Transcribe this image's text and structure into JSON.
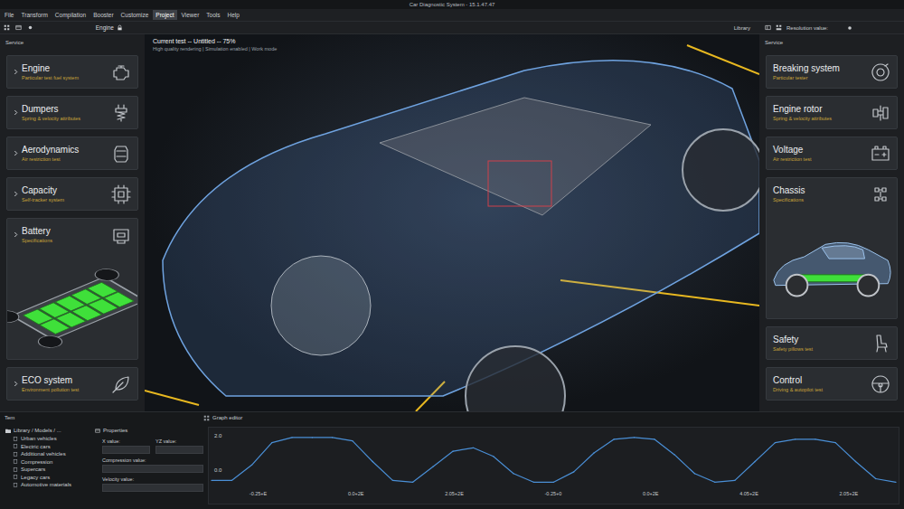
{
  "window": {
    "title": "Car Diagnostic System - 15.1.47.47"
  },
  "menu": [
    {
      "label": "File",
      "selected": false
    },
    {
      "label": "Transform",
      "selected": false
    },
    {
      "label": "Compilation",
      "selected": false
    },
    {
      "label": "Booster",
      "selected": false
    },
    {
      "label": "Customize",
      "selected": false
    },
    {
      "label": "Project",
      "selected": true
    },
    {
      "label": "Viewer",
      "selected": false
    },
    {
      "label": "Tools",
      "selected": false
    },
    {
      "label": "Help",
      "selected": false
    }
  ],
  "toolbar": {
    "document": "Engine",
    "library": "Library",
    "resolution_label": "Resolution value:"
  },
  "left_panel": {
    "title": "Service",
    "cards": [
      {
        "title": "Engine",
        "subtitle": "Particular test fuel system",
        "kind": "card"
      },
      {
        "title": "Dumpers",
        "subtitle": "Spring & velocity attributes",
        "kind": "card"
      },
      {
        "title": "Aerodynamics",
        "subtitle": "Air restriction test",
        "kind": "card"
      },
      {
        "title": "Capacity",
        "subtitle": "Self-tracker system",
        "kind": "card"
      },
      {
        "title": "Battery",
        "subtitle": "Specifications",
        "kind": "image"
      },
      {
        "title": "ECO system",
        "subtitle": "Environment pollution test",
        "kind": "card"
      }
    ]
  },
  "right_panel": {
    "title": "Service",
    "cards": [
      {
        "title": "Breaking system",
        "subtitle": "Particular tester",
        "kind": "card"
      },
      {
        "title": "Engine rotor",
        "subtitle": "Spring & velocity attributes",
        "kind": "card"
      },
      {
        "title": "Voltage",
        "subtitle": "Air restriction test",
        "kind": "card"
      },
      {
        "title": "Chassis",
        "subtitle": "Specifications",
        "kind": "image"
      },
      {
        "title": "Safety",
        "subtitle": "Safety pillows test",
        "kind": "card"
      },
      {
        "title": "Control",
        "subtitle": "Driving & autopilot test",
        "kind": "card"
      }
    ]
  },
  "viewport": {
    "status": "Current test -- Untitled -- 75%",
    "info": "High quality rendering | Simulation enabled | Work mode"
  },
  "tree": {
    "title": "Tem",
    "path": "Library / Models / ...",
    "items": [
      "Urban vehicles",
      "Electric cars",
      "Additional vehicles",
      "Compression",
      "Supercars",
      "Legacy cars",
      "Automotive materials"
    ]
  },
  "properties": {
    "title": "Properties",
    "fields": [
      {
        "label": "X value:",
        "value": ""
      },
      {
        "label": "YZ value:",
        "value": ""
      },
      {
        "label": "Compression value:",
        "value": ""
      },
      {
        "label": "Velocity value:",
        "value": ""
      }
    ]
  },
  "graph": {
    "title": "Graph editor",
    "y_ticks": [
      "2.0",
      "0.0"
    ],
    "x_ticks": [
      "-0.25+E",
      "0.0+2E",
      "2.05+2E",
      "-0.25+0",
      "0.0+2E",
      "4.05+2E",
      "2.05+2E"
    ],
    "series": [
      {
        "values": [
          -0.6,
          -0.6,
          0.3,
          1.6,
          1.9,
          1.9,
          1.9,
          1.7,
          0.5,
          -0.6,
          -0.7,
          0.2,
          1.1,
          1.3,
          0.8,
          -0.2,
          -0.7,
          -0.7,
          -0.1,
          1.0,
          1.8,
          1.9,
          1.8,
          0.9,
          -0.2,
          -0.7,
          -0.6,
          0.5,
          1.6,
          1.8,
          1.8,
          1.6,
          0.5,
          -0.5,
          -0.7
        ]
      }
    ]
  }
}
